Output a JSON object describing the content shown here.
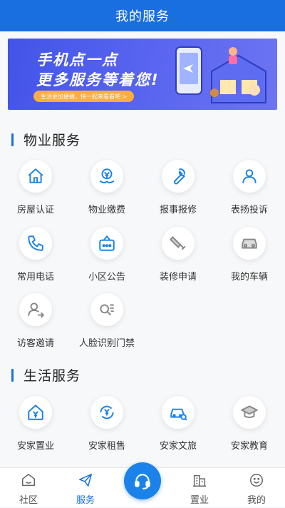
{
  "header": {
    "title": "我的服务"
  },
  "banner": {
    "line1": "手机点一点",
    "line2": "更多服务等着您!",
    "pill": "生活更加便捷，快一起来看看吧 >"
  },
  "property": {
    "title": "物业服务",
    "items": [
      {
        "label": "房屋认证",
        "icon": "house-icon"
      },
      {
        "label": "物业缴费",
        "icon": "payment-icon"
      },
      {
        "label": "报事报修",
        "icon": "wrench-icon"
      },
      {
        "label": "表扬投诉",
        "icon": "person-icon"
      },
      {
        "label": "常用电话",
        "icon": "phone-icon"
      },
      {
        "label": "小区公告",
        "icon": "notice-icon"
      },
      {
        "label": "装修申请",
        "icon": "paint-roller-icon"
      },
      {
        "label": "我的车辆",
        "icon": "car-icon"
      },
      {
        "label": "访客邀请",
        "icon": "visitor-icon"
      },
      {
        "label": "人脸识别门禁",
        "icon": "face-scan-icon"
      }
    ]
  },
  "life": {
    "title": "生活服务",
    "items": [
      {
        "label": "安家置业",
        "icon": "home-purchase-icon"
      },
      {
        "label": "安家租售",
        "icon": "rent-icon"
      },
      {
        "label": "安家文旅",
        "icon": "travel-icon"
      },
      {
        "label": "安家教育",
        "icon": "graduation-icon"
      }
    ]
  },
  "tabbar": {
    "items": [
      {
        "label": "社区",
        "icon": "community-icon"
      },
      {
        "label": "服务",
        "icon": "send-icon"
      },
      {
        "label": "",
        "icon": "headset-icon"
      },
      {
        "label": "置业",
        "icon": "building-icon"
      },
      {
        "label": "我的",
        "icon": "smile-icon"
      }
    ]
  },
  "colors": {
    "primary": "#1a6fe0",
    "icon": "#1a82e8"
  }
}
